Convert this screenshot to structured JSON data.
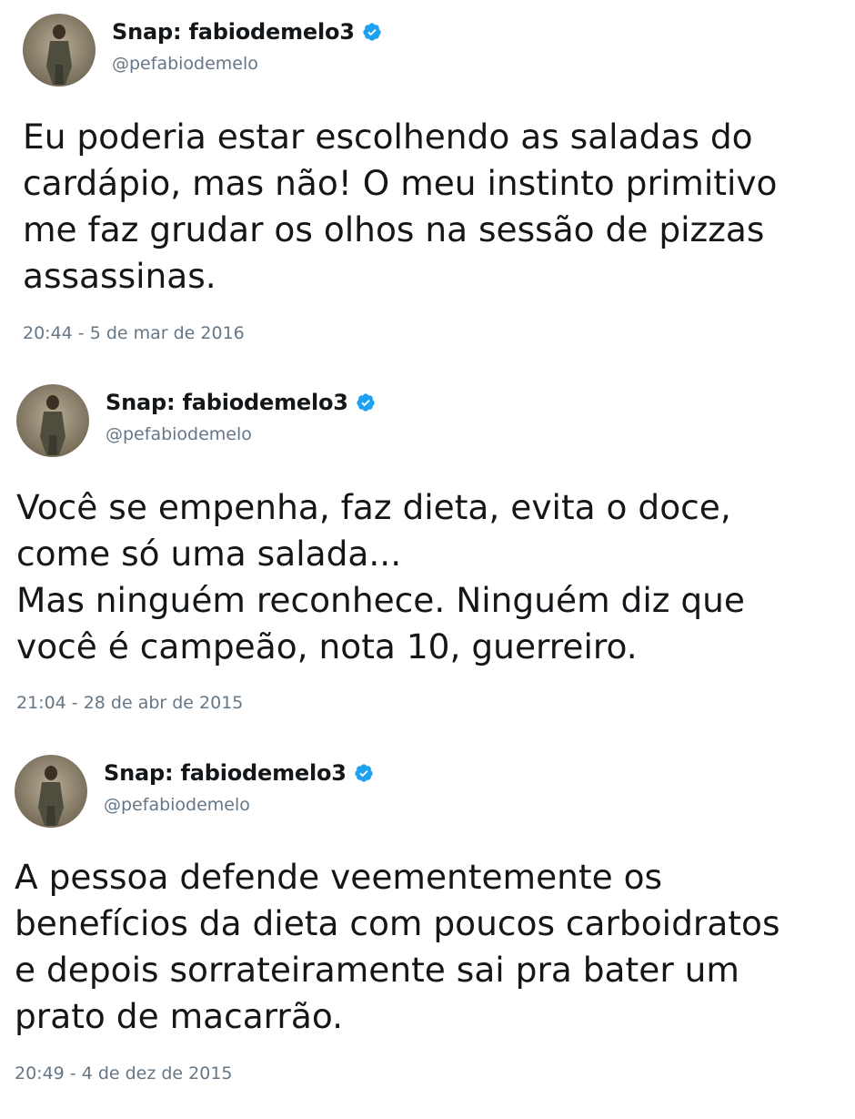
{
  "tweets": [
    {
      "display_name": "Snap: fabiodemelo3",
      "handle": "@pefabiodemelo",
      "text": "Eu poderia estar escolhendo as saladas do\ncardápio, mas não! O meu instinto primitivo\nme faz grudar os olhos na sessão de pizzas\nassassinas.",
      "timestamp": "20:44 - 5 de mar de 2016",
      "verified_icon": "verified-badge-icon"
    },
    {
      "display_name": "Snap: fabiodemelo3",
      "handle": "@pefabiodemelo",
      "text": "Você se empenha, faz dieta, evita o doce,\ncome só uma salada...\nMas ninguém reconhece. Ninguém diz que\nvocê é campeão, nota 10, guerreiro.",
      "timestamp": "21:04 - 28 de abr de 2015",
      "verified_icon": "verified-badge-icon"
    },
    {
      "display_name": "Snap: fabiodemelo3",
      "handle": "@pefabiodemelo",
      "text": "A pessoa defende veementemente os\nbenefícios da dieta com poucos carboidratos\ne depois sorrateiramente sai pra bater um\nprato de macarrão.",
      "timestamp": "20:49 - 4 de dez de 2015",
      "verified_icon": "verified-badge-icon"
    }
  ],
  "colors": {
    "text": "#14171a",
    "secondary": "#657786",
    "verified": "#1da1f2"
  }
}
